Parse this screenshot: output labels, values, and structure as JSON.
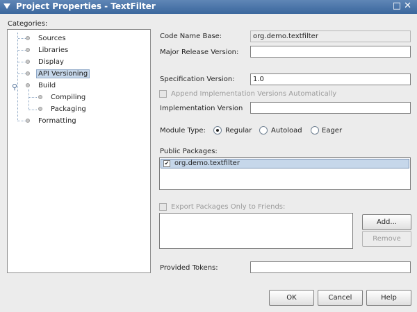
{
  "window": {
    "title": "Project Properties - TextFilter"
  },
  "categories": {
    "label": "Categories:",
    "items": [
      {
        "label": "Sources"
      },
      {
        "label": "Libraries"
      },
      {
        "label": "Display"
      },
      {
        "label": "API Versioning",
        "selected": true
      },
      {
        "label": "Build",
        "expanded": true
      },
      {
        "label": "Compiling"
      },
      {
        "label": "Packaging"
      },
      {
        "label": "Formatting"
      }
    ]
  },
  "form": {
    "code_name_base_label": "Code Name Base:",
    "code_name_base_value": "org.demo.textfilter",
    "major_release_label": "Major Release Version:",
    "major_release_value": "",
    "spec_version_label": "Specification Version:",
    "spec_version_value": "1.0",
    "append_impl_label": "Append Implementation Versions Automatically",
    "impl_version_label": "Implementation Version",
    "impl_version_value": "",
    "module_type_label": "Module Type:",
    "module_types": [
      {
        "label": "Regular",
        "checked": true
      },
      {
        "label": "Autoload",
        "checked": false
      },
      {
        "label": "Eager",
        "checked": false
      }
    ],
    "public_packages_label": "Public Packages:",
    "public_packages": [
      {
        "name": "org.demo.textfilter",
        "checked": true
      }
    ],
    "export_friends_label": "Export Packages Only to Friends:",
    "add_button": "Add...",
    "remove_button": "Remove",
    "provided_tokens_label": "Provided Tokens:",
    "provided_tokens_value": ""
  },
  "footer": {
    "ok": "OK",
    "cancel": "Cancel",
    "help": "Help"
  }
}
